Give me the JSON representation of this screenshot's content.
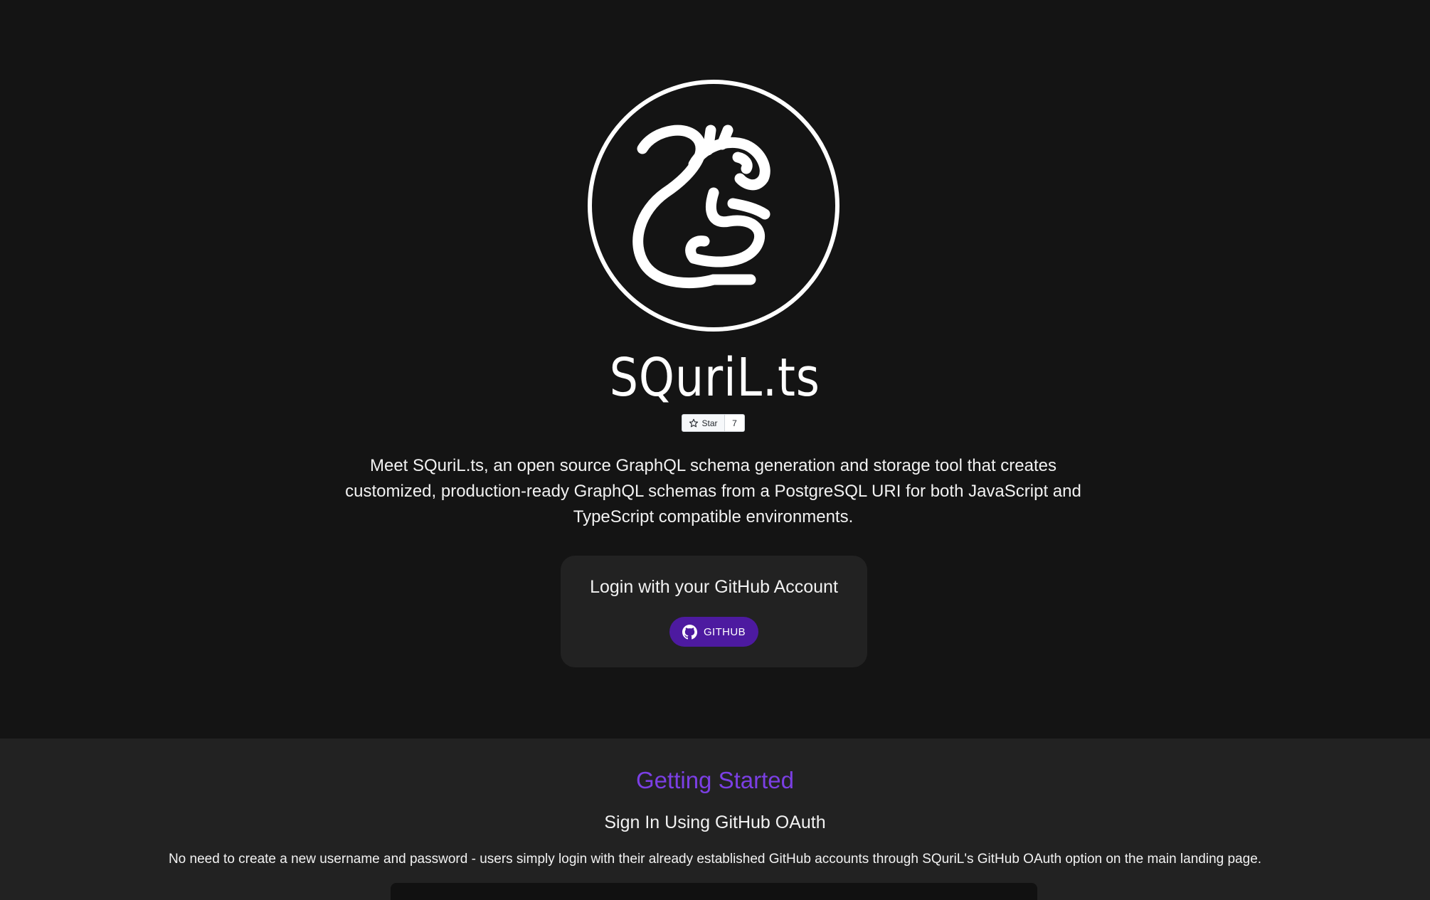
{
  "hero": {
    "logo_icon": "squirrel-logo-icon",
    "title": "SQuriL.ts",
    "star": {
      "label": "Star",
      "count": "7",
      "icon": "star-icon"
    },
    "description": "Meet SQuriL.ts, an open source GraphQL schema generation and storage tool that creates customized, production-ready GraphQL schemas from a PostgreSQL URI for both JavaScript and TypeScript compatible environments."
  },
  "login": {
    "title": "Login with your GitHub Account",
    "button_label": "GITHUB",
    "button_icon": "github-icon",
    "button_color": "#4d1aa0"
  },
  "getting_started": {
    "heading": "Getting Started",
    "subheading": "Sign In Using GitHub OAuth",
    "text": "No need to create a new username and password - users simply login with their already established GitHub accounts through SQuriL's GitHub OAuth option on the main landing page.",
    "heading_color": "#7b3fe4"
  },
  "colors": {
    "background": "#141414",
    "card": "#222222",
    "accent": "#7b3fe4"
  }
}
